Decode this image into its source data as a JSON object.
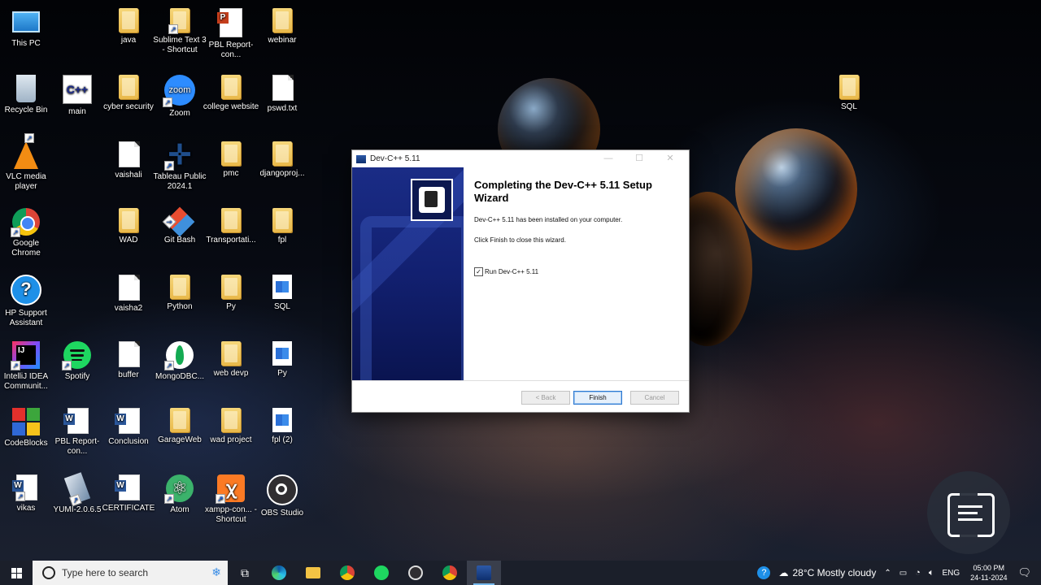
{
  "desktop": {
    "icons": {
      "this_pc": "This PC",
      "recycle_bin": "Recycle Bin",
      "vlc": "VLC media player",
      "chrome": "Google Chrome",
      "hp_support": "HP Support Assistant",
      "intellij": "IntelliJ IDEA Communit...",
      "codeblocks": "CodeBlocks",
      "vikas": "vikas",
      "main": "main",
      "spotify": "Spotify",
      "pbl_report_2": "PBL Report-con...",
      "yumi": "YUMI-2.0.6.5",
      "java": "java",
      "cyber_security": "cyber security",
      "vaishali": "vaishali",
      "wad": "WAD",
      "vaisha2": "vaisha2",
      "buffer": "buffer",
      "conclusion": "Conclusion",
      "certificate": "CERTIFICATE",
      "sublime": "Sublime Text 3 - Shortcut",
      "zoom": "Zoom",
      "tableau": "Tableau Public 2024.1",
      "git_bash": "Git Bash",
      "python": "Python",
      "mongodb": "MongoDBC...",
      "garageweb": "GarageWeb",
      "atom": "Atom",
      "pbl_report_1": "PBL Report-con...",
      "college_website": "college website",
      "pmc": "pmc",
      "transportation": "Transportati...",
      "py_1": "Py",
      "web_devp": "web devp",
      "wad_project": "wad project",
      "xampp": "xampp-con... - Shortcut",
      "webinar": "webinar",
      "pswd": "pswd.txt",
      "djangoproj": "djangoproj...",
      "fpl": "fpl",
      "sql_1": "SQL",
      "py_2": "Py",
      "fpl2": "fpl (2)",
      "obs": "OBS Studio",
      "sql_2": "SQL"
    }
  },
  "dialog": {
    "title": "Dev-C++ 5.11",
    "heading": "Completing the Dev-C++ 5.11 Setup Wizard",
    "installed_text": "Dev-C++ 5.11 has been installed on your computer.",
    "finish_text": "Click Finish to close this wizard.",
    "run_checkbox_label": "Run Dev-C++ 5.11",
    "run_checked": true,
    "back_label": "< Back",
    "finish_label": "Finish",
    "cancel_label": "Cancel"
  },
  "taskbar": {
    "search_placeholder": "Type here to search",
    "weather": "28°C  Mostly cloudy",
    "language": "ENG",
    "time": "05:00 PM",
    "date": "24-11-2024"
  }
}
